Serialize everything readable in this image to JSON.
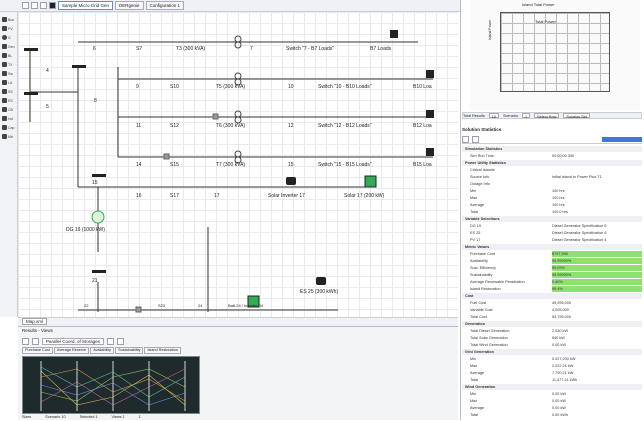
{
  "toolbar": {
    "tabs": [
      "Sample Micro Grid Gen",
      "DERgenie",
      "Configuration 1"
    ]
  },
  "palette": {
    "items": [
      "Bus",
      "PV",
      "G",
      "Gen",
      "BL",
      "TX",
      "Sw",
      "Ld",
      "SS",
      "ES",
      "CB",
      "Ind",
      "Cap",
      "Mtr"
    ]
  },
  "diagram": {
    "buses": [
      "4",
      "5",
      "8",
      "15",
      "21"
    ],
    "rows": [
      {
        "bus": "6",
        "cable": "S7",
        "transformer": "T3 (300 kVA)",
        "node": "7",
        "switch": "Switch \"7 - B7 Loads\"",
        "load": "B7 Loads"
      },
      {
        "bus": "9",
        "cable": "S10",
        "transformer": "T5 (300 kVA)",
        "node": "10",
        "switch": "Switch \"10 - B10 Loads\"",
        "load": "B10 Loa"
      },
      {
        "bus": "11",
        "cable": "S12",
        "transformer": "T6 (300 kVA)",
        "node": "12",
        "switch": "Switch \"12 - B12 Loads\"",
        "load": "B12 Loa"
      },
      {
        "bus": "14",
        "cable": "S15",
        "transformer": "T7 (300 kVA)",
        "node": "15",
        "switch": "Switch \"15 - B15 Loads\"",
        "load": "B15 Loa"
      }
    ],
    "solar_row": {
      "bus": "16",
      "cable": "S17",
      "node": "17",
      "inverter": "Solar Inverter 17",
      "pv": "Solar 17 (200 kW)"
    },
    "generator": "DG 19 (1000 kW)",
    "bottom_row": {
      "labels": [
        "22",
        "S23",
        "24",
        "Batt.24 / Inverter 24"
      ],
      "storage": "ES 25 (300 kWh)"
    }
  },
  "map_tab": "Map.xml",
  "bottom_panel": {
    "title": "Results - Views",
    "toolbar_label": "Parallel Coord. of Storages",
    "tabs": [
      "Purchase Cost",
      "Average Reserve",
      "Availability",
      "Sustainability",
      "Island Restoration"
    ],
    "status": [
      "Sizes",
      "Scenario 10",
      "Selected 1",
      "Views 1",
      "1"
    ]
  },
  "right_panel": {
    "minimap_title": "Island Total Power",
    "minimap_legend": "Total Power",
    "minimap_ylabel": "Island Power",
    "toolbar": [
      "Total Results",
      "10",
      "Scenario",
      "1",
      "Select Row",
      "Solution Set"
    ],
    "section_title": "Solution Statistics",
    "rows": [
      {
        "k": "Simulation Statistics",
        "v": "",
        "hdr": true
      },
      {
        "k": "Sim Run Time",
        "v": "00:00:00.390"
      },
      {
        "k": "Power Utility Statistics",
        "v": "",
        "hdr": true
      },
      {
        "k": "Critical Islands",
        "v": ""
      },
      {
        "k": "Source Info",
        "v": "Initial island to Power Plus T1"
      },
      {
        "k": "Outage Info",
        "v": ""
      },
      {
        "k": "Min",
        "v": "100 hrs"
      },
      {
        "k": "Max",
        "v": "100 hrs"
      },
      {
        "k": "Average",
        "v": "100 hrs"
      },
      {
        "k": "Total",
        "v": "100.0 hrs"
      },
      {
        "k": "Variable Selections",
        "v": "",
        "hdr": true
      },
      {
        "k": "DG 19",
        "v": "Diesel Generator Specification 6"
      },
      {
        "k": "ES 25",
        "v": "Diesel Generator Specification 6"
      },
      {
        "k": "PV 17",
        "v": "Diesel Generator Specification 4"
      },
      {
        "k": "Metric Values",
        "v": "",
        "hdr": true
      },
      {
        "k": "Purchase Cost",
        "v": "$797,995",
        "green": true
      },
      {
        "k": "Availability",
        "v": "99.99990%",
        "green": true
      },
      {
        "k": "Sust. Efficiency",
        "v": "99.09%",
        "green": true
      },
      {
        "k": "Sustainability",
        "v": "99.99990%",
        "green": true
      },
      {
        "k": "Average Renewable Penetration",
        "v": "0.40%",
        "green": true
      },
      {
        "k": "Island Restoration",
        "v": "99.4%",
        "green": true
      },
      {
        "k": "Cost",
        "v": "",
        "hdr": true
      },
      {
        "k": "Fuel Cost",
        "v": "49,995,000"
      },
      {
        "k": "Variable Cost",
        "v": "4,005,000"
      },
      {
        "k": "Total Cost",
        "v": "53,795,000"
      },
      {
        "k": "Generation",
        "v": "",
        "hdr": true
      },
      {
        "k": "Total Diesel Generation",
        "v": "2,030 kW"
      },
      {
        "k": "Total Solar Generation",
        "v": "640 kW"
      },
      {
        "k": "Total Wind Generation",
        "v": "0.00 kW"
      },
      {
        "k": "Grid Generation",
        "v": "",
        "hdr": true
      },
      {
        "k": "Min",
        "v": "0.027,200 kW"
      },
      {
        "k": "Max",
        "v": "2,222.21 kW"
      },
      {
        "k": "Average",
        "v": "7,700.21 kW"
      },
      {
        "k": "Total",
        "v": "11,477.21 kWh"
      },
      {
        "k": "Wind Generation",
        "v": "",
        "hdr": true
      },
      {
        "k": "Min",
        "v": "0.00 kW"
      },
      {
        "k": "Max",
        "v": "0.00 kW"
      },
      {
        "k": "Average",
        "v": "0.00 kW"
      },
      {
        "k": "Total",
        "v": "0.00 kWh"
      }
    ]
  },
  "colors": {
    "accent": "#3b78d8",
    "green_metric": "#8fe06f",
    "plot_bg": "#1f2a2c"
  }
}
